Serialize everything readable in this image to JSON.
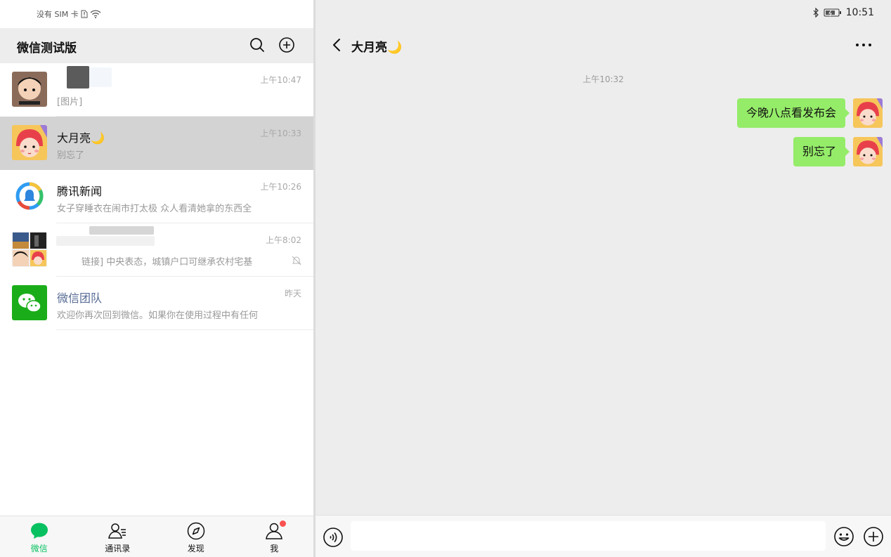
{
  "status_bar": {
    "carrier": "没有 SIM 卡",
    "time": "10:51"
  },
  "left_header": {
    "title": "微信测试版"
  },
  "conversations": [
    {
      "name": "",
      "preview": "[图片]",
      "time": "上午10:47",
      "blurred": true
    },
    {
      "name": "大月亮🌙",
      "preview": "别忘了",
      "time": "上午10:33",
      "active": true
    },
    {
      "name": "腾讯新闻",
      "preview": "女子穿睡衣在闹市打太极 众人看清她拿的东西全",
      "time": "上午10:26"
    },
    {
      "name": "",
      "preview": "链接] 中央表态，城镇户口可继承农村宅基",
      "time": "上午8:02",
      "muted": true,
      "blurred": true
    },
    {
      "name": "微信团队",
      "preview": "欢迎你再次回到微信。如果你在使用过程中有任何",
      "time": "昨天"
    }
  ],
  "tabbar": {
    "tabs": [
      {
        "label": "微信",
        "icon": "chat-bubble-icon",
        "active": true
      },
      {
        "label": "通讯录",
        "icon": "contacts-icon"
      },
      {
        "label": "发现",
        "icon": "compass-icon"
      },
      {
        "label": "我",
        "icon": "person-icon",
        "badge": true
      }
    ]
  },
  "chat": {
    "title": "大月亮🌙",
    "timestamp": "上午10:32",
    "messages": [
      {
        "text": "今晚八点看发布会",
        "sender": "self"
      },
      {
        "text": "别忘了",
        "sender": "self"
      }
    ],
    "input": {
      "value": "",
      "placeholder": ""
    }
  },
  "colors": {
    "accent": "#07c160",
    "bubble": "#95ec69",
    "badge": "#fa5151",
    "link_name": "#576b95"
  }
}
